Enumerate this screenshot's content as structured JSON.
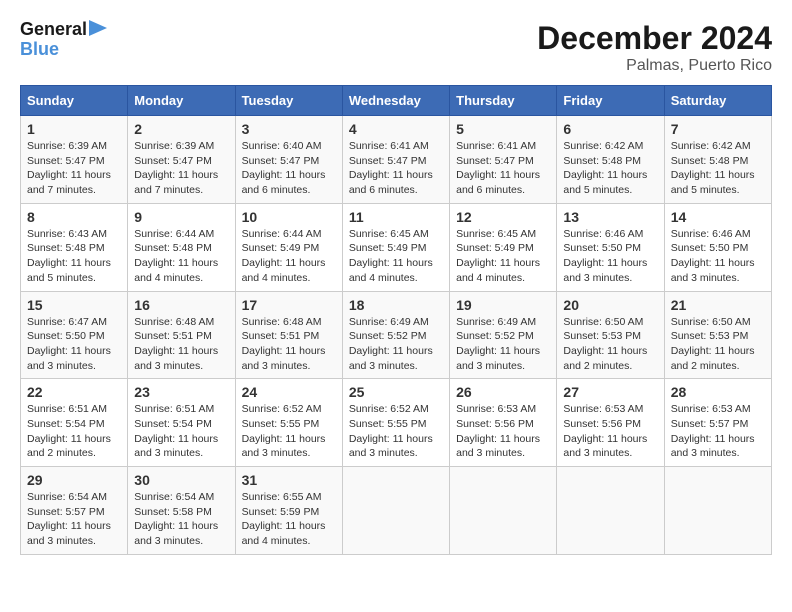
{
  "logo": {
    "line1": "General",
    "line2": "Blue"
  },
  "title": "December 2024",
  "location": "Palmas, Puerto Rico",
  "days_header": [
    "Sunday",
    "Monday",
    "Tuesday",
    "Wednesday",
    "Thursday",
    "Friday",
    "Saturday"
  ],
  "weeks": [
    [
      {
        "day": "1",
        "sunrise": "6:39 AM",
        "sunset": "5:47 PM",
        "daylight": "11 hours and 7 minutes."
      },
      {
        "day": "2",
        "sunrise": "6:39 AM",
        "sunset": "5:47 PM",
        "daylight": "11 hours and 7 minutes."
      },
      {
        "day": "3",
        "sunrise": "6:40 AM",
        "sunset": "5:47 PM",
        "daylight": "11 hours and 6 minutes."
      },
      {
        "day": "4",
        "sunrise": "6:41 AM",
        "sunset": "5:47 PM",
        "daylight": "11 hours and 6 minutes."
      },
      {
        "day": "5",
        "sunrise": "6:41 AM",
        "sunset": "5:47 PM",
        "daylight": "11 hours and 6 minutes."
      },
      {
        "day": "6",
        "sunrise": "6:42 AM",
        "sunset": "5:48 PM",
        "daylight": "11 hours and 5 minutes."
      },
      {
        "day": "7",
        "sunrise": "6:42 AM",
        "sunset": "5:48 PM",
        "daylight": "11 hours and 5 minutes."
      }
    ],
    [
      {
        "day": "8",
        "sunrise": "6:43 AM",
        "sunset": "5:48 PM",
        "daylight": "11 hours and 5 minutes."
      },
      {
        "day": "9",
        "sunrise": "6:44 AM",
        "sunset": "5:48 PM",
        "daylight": "11 hours and 4 minutes."
      },
      {
        "day": "10",
        "sunrise": "6:44 AM",
        "sunset": "5:49 PM",
        "daylight": "11 hours and 4 minutes."
      },
      {
        "day": "11",
        "sunrise": "6:45 AM",
        "sunset": "5:49 PM",
        "daylight": "11 hours and 4 minutes."
      },
      {
        "day": "12",
        "sunrise": "6:45 AM",
        "sunset": "5:49 PM",
        "daylight": "11 hours and 4 minutes."
      },
      {
        "day": "13",
        "sunrise": "6:46 AM",
        "sunset": "5:50 PM",
        "daylight": "11 hours and 3 minutes."
      },
      {
        "day": "14",
        "sunrise": "6:46 AM",
        "sunset": "5:50 PM",
        "daylight": "11 hours and 3 minutes."
      }
    ],
    [
      {
        "day": "15",
        "sunrise": "6:47 AM",
        "sunset": "5:50 PM",
        "daylight": "11 hours and 3 minutes."
      },
      {
        "day": "16",
        "sunrise": "6:48 AM",
        "sunset": "5:51 PM",
        "daylight": "11 hours and 3 minutes."
      },
      {
        "day": "17",
        "sunrise": "6:48 AM",
        "sunset": "5:51 PM",
        "daylight": "11 hours and 3 minutes."
      },
      {
        "day": "18",
        "sunrise": "6:49 AM",
        "sunset": "5:52 PM",
        "daylight": "11 hours and 3 minutes."
      },
      {
        "day": "19",
        "sunrise": "6:49 AM",
        "sunset": "5:52 PM",
        "daylight": "11 hours and 3 minutes."
      },
      {
        "day": "20",
        "sunrise": "6:50 AM",
        "sunset": "5:53 PM",
        "daylight": "11 hours and 2 minutes."
      },
      {
        "day": "21",
        "sunrise": "6:50 AM",
        "sunset": "5:53 PM",
        "daylight": "11 hours and 2 minutes."
      }
    ],
    [
      {
        "day": "22",
        "sunrise": "6:51 AM",
        "sunset": "5:54 PM",
        "daylight": "11 hours and 2 minutes."
      },
      {
        "day": "23",
        "sunrise": "6:51 AM",
        "sunset": "5:54 PM",
        "daylight": "11 hours and 3 minutes."
      },
      {
        "day": "24",
        "sunrise": "6:52 AM",
        "sunset": "5:55 PM",
        "daylight": "11 hours and 3 minutes."
      },
      {
        "day": "25",
        "sunrise": "6:52 AM",
        "sunset": "5:55 PM",
        "daylight": "11 hours and 3 minutes."
      },
      {
        "day": "26",
        "sunrise": "6:53 AM",
        "sunset": "5:56 PM",
        "daylight": "11 hours and 3 minutes."
      },
      {
        "day": "27",
        "sunrise": "6:53 AM",
        "sunset": "5:56 PM",
        "daylight": "11 hours and 3 minutes."
      },
      {
        "day": "28",
        "sunrise": "6:53 AM",
        "sunset": "5:57 PM",
        "daylight": "11 hours and 3 minutes."
      }
    ],
    [
      {
        "day": "29",
        "sunrise": "6:54 AM",
        "sunset": "5:57 PM",
        "daylight": "11 hours and 3 minutes."
      },
      {
        "day": "30",
        "sunrise": "6:54 AM",
        "sunset": "5:58 PM",
        "daylight": "11 hours and 3 minutes."
      },
      {
        "day": "31",
        "sunrise": "6:55 AM",
        "sunset": "5:59 PM",
        "daylight": "11 hours and 4 minutes."
      },
      null,
      null,
      null,
      null
    ]
  ],
  "labels": {
    "sunrise_prefix": "Sunrise: ",
    "sunset_prefix": "Sunset: ",
    "daylight_prefix": "Daylight: "
  }
}
